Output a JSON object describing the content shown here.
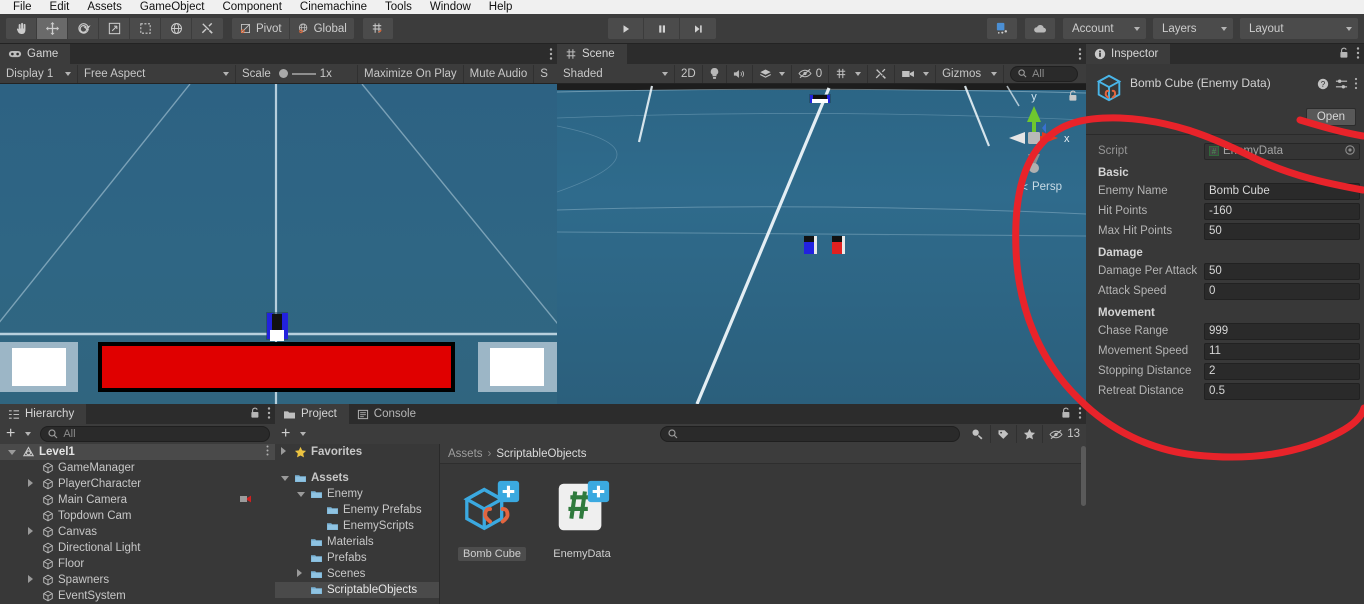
{
  "menu": {
    "items": [
      "File",
      "Edit",
      "Assets",
      "GameObject",
      "Component",
      "Cinemachine",
      "Tools",
      "Window",
      "Help"
    ]
  },
  "toolbar": {
    "tools": [
      "hand-tool",
      "move-tool",
      "rotate-tool",
      "scale-tool",
      "rect-tool",
      "transform-tool",
      "custom-tool"
    ],
    "pivot_label": "Pivot",
    "global_label": "Global",
    "snap_label": "snap-grid",
    "play_label": "play-button",
    "pause_label": "pause-button",
    "step_label": "step-button",
    "collab_label": "collab-icon",
    "cloud_label": "cloud-icon",
    "account_label": "Account",
    "layers_label": "Layers",
    "layout_label": "Layout"
  },
  "game": {
    "tab_label": "Game",
    "display": "Display 1",
    "aspect": "Free Aspect",
    "scale_label": "Scale",
    "scale_value": "1x",
    "maximize": "Maximize On Play",
    "mute": "Mute Audio",
    "stats": "S",
    "healthbar_color": "#e00000"
  },
  "scene": {
    "tab_label": "Scene",
    "shading": "Shaded",
    "mode_2d": "2D",
    "hidden_count": "0",
    "gizmos_label": "Gizmos",
    "search_placeholder": "All",
    "persp_label": "Persp",
    "axis_x": "x",
    "axis_y": "y"
  },
  "inspector": {
    "tab_label": "Inspector",
    "object_title": "Bomb Cube (Enemy Data)",
    "open_label": "Open",
    "script_label": "Script",
    "script_value": "EnemyData",
    "groups": [
      {
        "title": "Basic",
        "fields": [
          {
            "label": "Enemy Name",
            "value": "Bomb Cube"
          },
          {
            "label": "Hit Points",
            "value": "-160"
          },
          {
            "label": "Max Hit Points",
            "value": "50"
          }
        ]
      },
      {
        "title": "Damage",
        "fields": [
          {
            "label": "Damage Per Attack",
            "value": "50"
          },
          {
            "label": "Attack Speed",
            "value": "0"
          }
        ]
      },
      {
        "title": "Movement",
        "fields": [
          {
            "label": "Chase Range",
            "value": "999"
          },
          {
            "label": "Movement Speed",
            "value": "11"
          },
          {
            "label": "Stopping Distance",
            "value": "2"
          },
          {
            "label": "Retreat Distance",
            "value": "0.5"
          }
        ]
      }
    ]
  },
  "hierarchy": {
    "tab_label": "Hierarchy",
    "search_placeholder": "All",
    "items": [
      {
        "label": "Level1",
        "depth": 0,
        "arrow": "open",
        "selected": true,
        "icon": "unity-scene-icon"
      },
      {
        "label": "GameManager",
        "depth": 1,
        "arrow": "none",
        "selected": false,
        "icon": "gameobject-icon"
      },
      {
        "label": "PlayerCharacter",
        "depth": 1,
        "arrow": "closed",
        "selected": false,
        "icon": "gameobject-icon"
      },
      {
        "label": "Main Camera",
        "depth": 1,
        "arrow": "none",
        "selected": false,
        "icon": "gameobject-icon"
      },
      {
        "label": "Topdown Cam",
        "depth": 1,
        "arrow": "none",
        "selected": false,
        "icon": "gameobject-icon"
      },
      {
        "label": "Canvas",
        "depth": 1,
        "arrow": "closed",
        "selected": false,
        "icon": "gameobject-icon"
      },
      {
        "label": "Directional Light",
        "depth": 1,
        "arrow": "none",
        "selected": false,
        "icon": "gameobject-icon"
      },
      {
        "label": "Floor",
        "depth": 1,
        "arrow": "none",
        "selected": false,
        "icon": "gameobject-icon"
      },
      {
        "label": "Spawners",
        "depth": 1,
        "arrow": "closed",
        "selected": false,
        "icon": "gameobject-icon"
      },
      {
        "label": "EventSystem",
        "depth": 1,
        "arrow": "none",
        "selected": false,
        "icon": "gameobject-icon"
      }
    ]
  },
  "project": {
    "tab_label": "Project",
    "console_tab_label": "Console",
    "search_placeholder": "",
    "hidden_count": "13",
    "breadcrumb": [
      "Assets",
      "ScriptableObjects"
    ],
    "tree": [
      {
        "label": "Favorites",
        "depth": 0,
        "arrow": "closed",
        "icon": "star-icon",
        "selected": false
      },
      {
        "label": "",
        "depth": 0,
        "arrow": "none",
        "icon": "spacer",
        "selected": false
      },
      {
        "label": "Assets",
        "depth": 0,
        "arrow": "open",
        "icon": "folder-icon",
        "selected": false
      },
      {
        "label": "Enemy",
        "depth": 1,
        "arrow": "open",
        "icon": "folder-icon",
        "selected": false
      },
      {
        "label": "Enemy Prefabs",
        "depth": 2,
        "arrow": "none",
        "icon": "folder-icon",
        "selected": false
      },
      {
        "label": "EnemyScripts",
        "depth": 2,
        "arrow": "none",
        "icon": "folder-icon",
        "selected": false
      },
      {
        "label": "Materials",
        "depth": 1,
        "arrow": "none",
        "icon": "folder-icon",
        "selected": false
      },
      {
        "label": "Prefabs",
        "depth": 1,
        "arrow": "none",
        "icon": "folder-icon",
        "selected": false
      },
      {
        "label": "Scenes",
        "depth": 1,
        "arrow": "closed",
        "icon": "folder-icon",
        "selected": false
      },
      {
        "label": "ScriptableObjects",
        "depth": 1,
        "arrow": "none",
        "icon": "folder-icon",
        "selected": true
      }
    ],
    "assets": [
      {
        "label": "Bomb Cube",
        "icon": "scriptable-object-icon",
        "selected": true
      },
      {
        "label": "EnemyData",
        "icon": "csharp-script-icon",
        "selected": false
      }
    ]
  },
  "annotation": {
    "color": "#e8232a",
    "shape": "hand-drawn-lasso"
  }
}
